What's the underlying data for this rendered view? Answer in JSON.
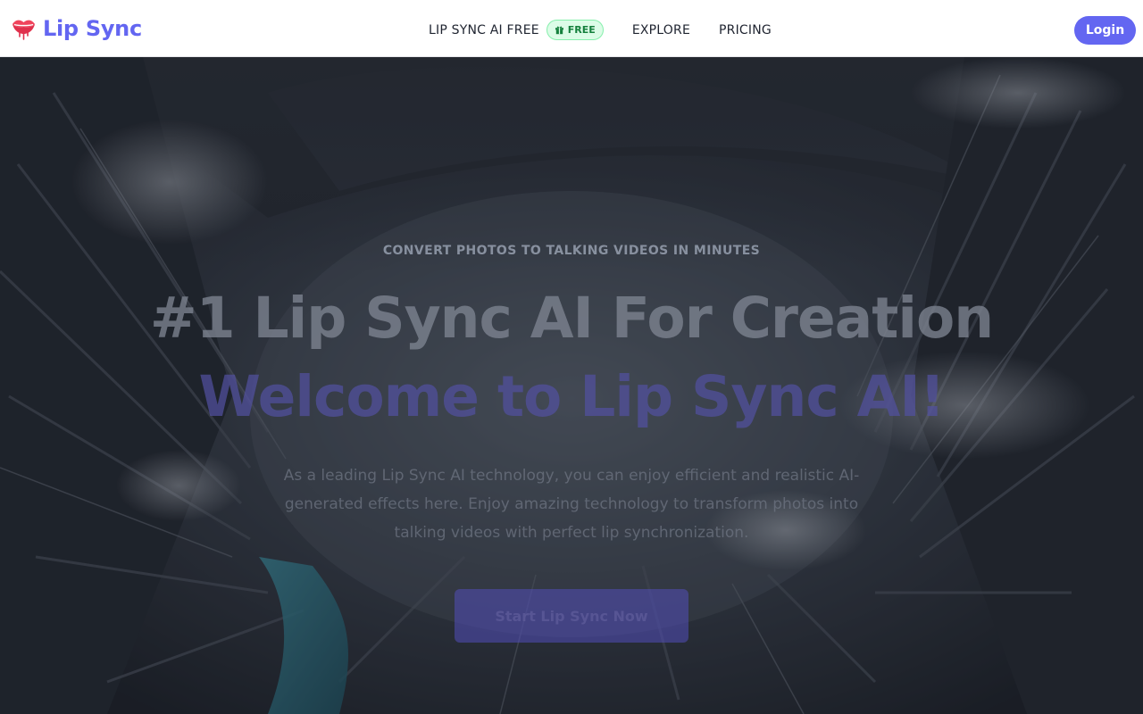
{
  "brand": {
    "name": "Lip Sync",
    "icon": "lips-icon",
    "color": "#6366f1"
  },
  "nav": {
    "free_link": "LIP SYNC AI FREE",
    "free_badge": "FREE",
    "free_badge_icon": "gift-icon",
    "explore": "EXPLORE",
    "pricing": "PRICING"
  },
  "login_label": "Login",
  "hero": {
    "eyebrow": "CONVERT PHOTOS TO TALKING VIDEOS IN MINUTES",
    "headline": "#1 Lip Sync AI For Creation",
    "subheadline": "Welcome to Lip Sync AI!",
    "description": "As a leading Lip Sync AI technology, you can enjoy efficient and realistic AI-generated effects here. Enjoy amazing technology to transform photos into talking videos with perfect lip synchronization.",
    "cta_label": "Start Lip Sync Now"
  },
  "colors": {
    "accent": "#6366f1",
    "badge_bg": "#dcfce7",
    "badge_text": "#15803d"
  }
}
